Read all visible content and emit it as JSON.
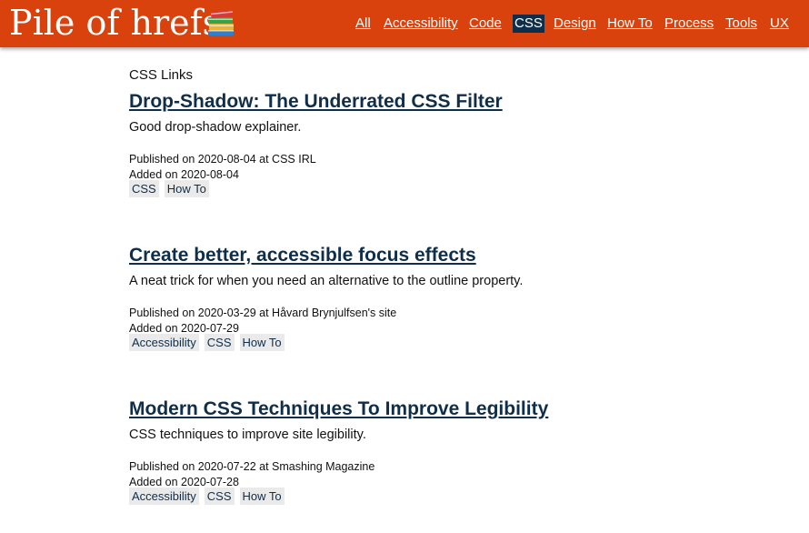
{
  "header": {
    "site_title": "Pile of hrefs",
    "icon": "books-icon",
    "background_color": "#d9410d",
    "nav": [
      {
        "label": "All",
        "active": false
      },
      {
        "label": "Accessibility",
        "active": false
      },
      {
        "label": "Code",
        "active": false
      },
      {
        "label": "CSS",
        "active": true
      },
      {
        "label": "Design",
        "active": false
      },
      {
        "label": "How To",
        "active": false
      },
      {
        "label": "Process",
        "active": false
      },
      {
        "label": "Tools",
        "active": false
      },
      {
        "label": "UX",
        "active": false
      }
    ],
    "active_color": "#0f2e4a"
  },
  "main": {
    "section_label": "CSS Links",
    "articles": [
      {
        "title": "Drop-Shadow: The Underrated CSS Filter",
        "description": "Good drop-shadow explainer.",
        "published": "Published on 2020-08-04 at CSS IRL",
        "added": "Added on 2020-08-04",
        "tags": [
          "CSS",
          "How To"
        ]
      },
      {
        "title": "Create better, accessible focus effects",
        "description": "A neat trick for when you need an alternative to the outline property.",
        "published": "Published on 2020-03-29 at Håvard Brynjulfsen's site",
        "added": "Added on 2020-07-29",
        "tags": [
          "Accessibility",
          "CSS",
          "How To"
        ]
      },
      {
        "title": "Modern CSS Techniques To Improve Legibility",
        "description": "CSS techniques to improve site legibility.",
        "published": "Published on 2020-07-22 at Smashing Magazine",
        "added": "Added on 2020-07-28",
        "tags": [
          "Accessibility",
          "CSS",
          "How To"
        ]
      }
    ]
  }
}
